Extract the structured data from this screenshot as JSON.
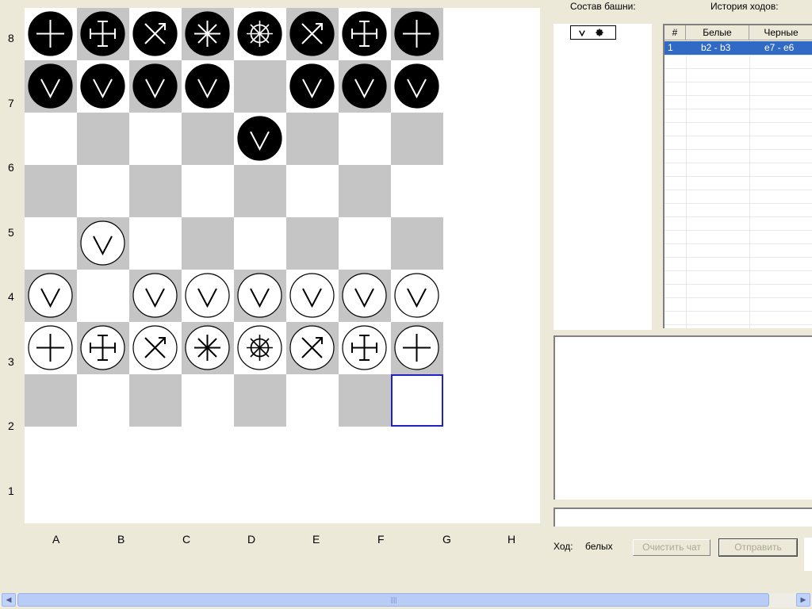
{
  "board": {
    "rank_labels": [
      "8",
      "7",
      "6",
      "5",
      "4",
      "3",
      "2",
      "1"
    ],
    "file_labels": [
      "A",
      "B",
      "C",
      "D",
      "E",
      "F",
      "G",
      "H"
    ],
    "light_color": "#FFFFFF",
    "dark_color": "#C5C5C5",
    "selection_square": {
      "file": 7,
      "rank": 1
    },
    "pieces": [
      {
        "square": "a8",
        "color": "black",
        "symbol": "cross"
      },
      {
        "square": "b8",
        "color": "black",
        "symbol": "cross-serif"
      },
      {
        "square": "c8",
        "color": "black",
        "symbol": "x-arrow"
      },
      {
        "square": "d8",
        "color": "black",
        "symbol": "asterisk"
      },
      {
        "square": "e8",
        "color": "black",
        "symbol": "wheel"
      },
      {
        "square": "f8",
        "color": "black",
        "symbol": "x-arrow"
      },
      {
        "square": "g8",
        "color": "black",
        "symbol": "cross-serif"
      },
      {
        "square": "h8",
        "color": "black",
        "symbol": "cross"
      },
      {
        "square": "a7",
        "color": "black",
        "symbol": "v"
      },
      {
        "square": "b7",
        "color": "black",
        "symbol": "v"
      },
      {
        "square": "c7",
        "color": "black",
        "symbol": "v"
      },
      {
        "square": "d7",
        "color": "black",
        "symbol": "v"
      },
      {
        "square": "f7",
        "color": "black",
        "symbol": "v"
      },
      {
        "square": "g7",
        "color": "black",
        "symbol": "v"
      },
      {
        "square": "h7",
        "color": "black",
        "symbol": "v"
      },
      {
        "square": "e6",
        "color": "black",
        "symbol": "v"
      },
      {
        "square": "b4",
        "color": "white",
        "symbol": "v"
      },
      {
        "square": "a3",
        "color": "white",
        "symbol": "v"
      },
      {
        "square": "c3",
        "color": "white",
        "symbol": "v"
      },
      {
        "square": "d3",
        "color": "white",
        "symbol": "v"
      },
      {
        "square": "e3",
        "color": "white",
        "symbol": "v"
      },
      {
        "square": "f3",
        "color": "white",
        "symbol": "v"
      },
      {
        "square": "g3",
        "color": "white",
        "symbol": "v"
      },
      {
        "square": "h3",
        "color": "white",
        "symbol": "v"
      },
      {
        "square": "a2",
        "color": "white",
        "symbol": "cross"
      },
      {
        "square": "b2",
        "color": "white",
        "symbol": "cross-serif"
      },
      {
        "square": "c2",
        "color": "white",
        "symbol": "x-arrow"
      },
      {
        "square": "d2",
        "color": "white",
        "symbol": "asterisk"
      },
      {
        "square": "e2",
        "color": "white",
        "symbol": "wheel"
      },
      {
        "square": "f2",
        "color": "white",
        "symbol": "x-arrow"
      },
      {
        "square": "g2",
        "color": "white",
        "symbol": "cross-serif"
      },
      {
        "square": "h2",
        "color": "white",
        "symbol": "cross"
      }
    ]
  },
  "tower": {
    "title": "Состав башни:",
    "items": [
      "v",
      "wheel"
    ]
  },
  "history": {
    "title": "История ходов:",
    "columns": [
      "#",
      "Белые",
      "Черные"
    ],
    "rows": [
      {
        "num": "1",
        "white": "b2 - b3",
        "black": "e7 - e6"
      }
    ],
    "selected_color": "#316AC5"
  },
  "chat": {
    "input_value": ""
  },
  "status": {
    "turn_label": "Ход:",
    "turn_value": "белых"
  },
  "buttons": {
    "clear_chat": "Очистить чат",
    "send": "Отправить"
  },
  "icons": {
    "scroll_left": "arrow-left-icon",
    "scroll_right": "arrow-right-icon"
  }
}
